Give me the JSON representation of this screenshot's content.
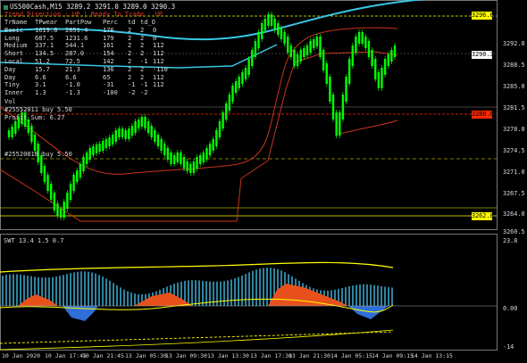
{
  "header": {
    "symbol_line": "US500Cash,M15  3289.2 3291.0 3289.0 3290.3"
  },
  "trend_line": "Trend Direction : UP | Ready To Trade : UP",
  "stats_table": {
    "headers": [
      "TrName",
      "TPwear",
      "PartPow",
      "Perc",
      "td",
      "td_O"
    ],
    "rows": [
      [
        "Basic",
        "1619.8",
        "2851.4",
        "176",
        "2",
        "2",
        "0"
      ],
      [
        "Long",
        "687.5",
        "1231.6",
        "179",
        "2",
        "2",
        "0"
      ],
      [
        "Medium",
        "337.1",
        "544.1",
        "161",
        "2",
        "2",
        "112"
      ],
      [
        "Short",
        "134.5",
        "287.0",
        "154",
        "2",
        "2",
        "112"
      ],
      [
        "Local",
        "51.2",
        "72.5",
        "142",
        "2",
        "-1",
        "112"
      ],
      [
        "Day",
        "15.7",
        "21.3",
        "136",
        "2",
        "2",
        "-110"
      ],
      [
        "Day",
        "6.6",
        "6.6",
        "65",
        "2",
        "2",
        "112"
      ],
      [
        "Tiny",
        "3.1",
        "-1.0",
        "-31",
        "-1",
        "-1",
        "112"
      ],
      [
        "Inner",
        "1.3",
        "-1.3",
        "-100",
        "-2",
        "-2",
        ""
      ]
    ]
  },
  "labels": {
    "vol": "Vol",
    "ord1": "#25552011 buy 5.50",
    "profit": "Profit_Sum: 6.27",
    "ord2": "#25520818 buy 5.50"
  },
  "price_axis": {
    "ticks": [
      "3292.0",
      "3288.5",
      "3285.0",
      "3281.5",
      "3278.0",
      "3274.5",
      "3271.0",
      "3267.5",
      "3264.0",
      "3260.5"
    ],
    "ind_ticks": [
      "23.8",
      "0.00",
      "-14"
    ],
    "tags": {
      "high": "3296.6",
      "current": "3290.3",
      "red": "3280.0",
      "low": "3262.8"
    }
  },
  "time_axis": [
    "10 Jan 2020",
    "10 Jan 17:45",
    "10 Jan 21:45",
    "13 Jan 05:30",
    "13 Jan 09:30",
    "13 Jan 13:30",
    "13 Jan 17:30",
    "13 Jan 21:30",
    "14 Jan 05:15",
    "14 Jan 09:15",
    "14 Jan 13:15"
  ],
  "indicator": {
    "title": "SWT 13.4 1.5 0.7"
  },
  "colors": {
    "bull": "#00ff00",
    "bear": "#00ff00",
    "cyan": "#39c6e6",
    "red": "#c8361c",
    "yellow": "#ffff00",
    "grid": "#3a3a3a",
    "tag_yellow": "#ffff00",
    "tag_red": "#ff2a00",
    "tag_white": "#ffffff"
  }
}
